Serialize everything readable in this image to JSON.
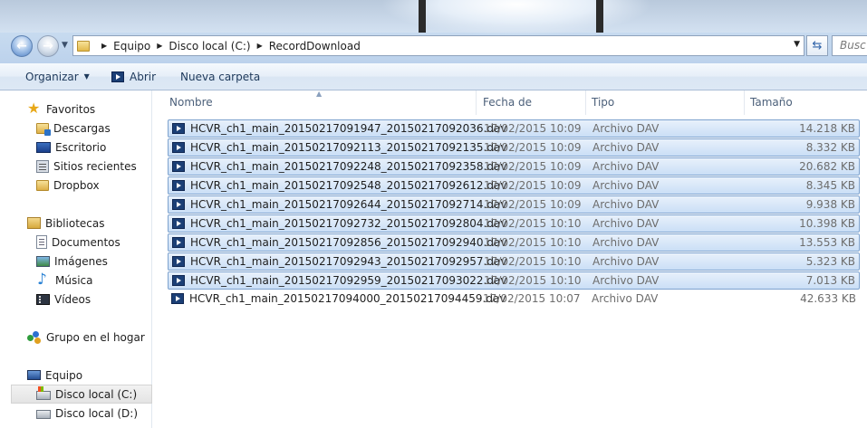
{
  "address": {
    "crumbs": [
      "Equipo",
      "Disco local (C:)",
      "RecordDownload"
    ],
    "search_placeholder": "Busc"
  },
  "toolbar": {
    "organize": "Organizar",
    "open": "Abrir",
    "new_folder": "Nueva carpeta"
  },
  "nav": {
    "favorites": "Favoritos",
    "favorites_items": [
      "Descargas",
      "Escritorio",
      "Sitios recientes",
      "Dropbox"
    ],
    "libraries": "Bibliotecas",
    "library_items": [
      "Documentos",
      "Imágenes",
      "Música",
      "Vídeos"
    ],
    "homegroup": "Grupo en el hogar",
    "computer": "Equipo",
    "drives": [
      "Disco local (C:)",
      "Disco local (D:)"
    ]
  },
  "columns": [
    "Nombre",
    "Fecha de modifica...",
    "Tipo",
    "Tamaño"
  ],
  "files": [
    {
      "name": "HCVR_ch1_main_20150217091947_20150217092036.dav",
      "date": "17/02/2015 10:09",
      "type": "Archivo DAV",
      "size": "14.218 KB",
      "selected": true
    },
    {
      "name": "HCVR_ch1_main_20150217092113_20150217092135.dav",
      "date": "17/02/2015 10:09",
      "type": "Archivo DAV",
      "size": "8.332 KB",
      "selected": true
    },
    {
      "name": "HCVR_ch1_main_20150217092248_20150217092358.dav",
      "date": "17/02/2015 10:09",
      "type": "Archivo DAV",
      "size": "20.682 KB",
      "selected": true
    },
    {
      "name": "HCVR_ch1_main_20150217092548_20150217092612.dav",
      "date": "17/02/2015 10:09",
      "type": "Archivo DAV",
      "size": "8.345 KB",
      "selected": true
    },
    {
      "name": "HCVR_ch1_main_20150217092644_20150217092714.dav",
      "date": "17/02/2015 10:09",
      "type": "Archivo DAV",
      "size": "9.938 KB",
      "selected": true
    },
    {
      "name": "HCVR_ch1_main_20150217092732_20150217092804.dav",
      "date": "17/02/2015 10:10",
      "type": "Archivo DAV",
      "size": "10.398 KB",
      "selected": true
    },
    {
      "name": "HCVR_ch1_main_20150217092856_20150217092940.dav",
      "date": "17/02/2015 10:10",
      "type": "Archivo DAV",
      "size": "13.553 KB",
      "selected": true
    },
    {
      "name": "HCVR_ch1_main_20150217092943_20150217092957.dav",
      "date": "17/02/2015 10:10",
      "type": "Archivo DAV",
      "size": "5.323 KB",
      "selected": true
    },
    {
      "name": "HCVR_ch1_main_20150217092959_20150217093022.dav",
      "date": "17/02/2015 10:10",
      "type": "Archivo DAV",
      "size": "7.013 KB",
      "selected": true
    },
    {
      "name": "HCVR_ch1_main_20150217094000_20150217094459.dav",
      "date": "17/02/2015 10:07",
      "type": "Archivo DAV",
      "size": "42.633 KB",
      "selected": false
    }
  ]
}
